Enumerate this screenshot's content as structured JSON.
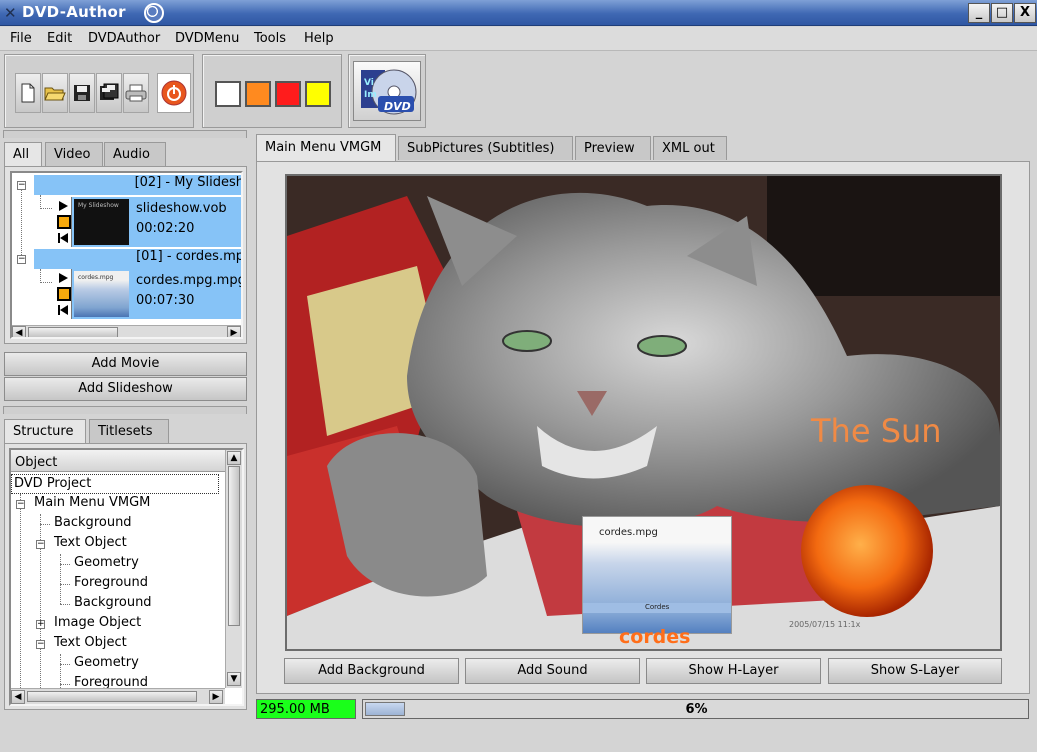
{
  "window": {
    "title": "DVD-Author",
    "min": "_",
    "max": "□",
    "close": "X"
  },
  "menu": [
    "File",
    "Edit",
    "DVDAuthor",
    "DVDMenu",
    "Tools",
    "Help"
  ],
  "toolbar": {
    "swatch_colors": [
      "#ffffff",
      "#ff8a1f",
      "#ff1c1c",
      "#ffff00"
    ],
    "logo_text": "DVD",
    "logo_tag_1": "Vi",
    "logo_tag_2": "Im"
  },
  "source_tabs": [
    "All",
    "Video",
    "Audio"
  ],
  "sources": [
    {
      "title": "[02] - My Slidesh",
      "file": "slideshow.vob",
      "duration": "00:02:20",
      "thumb_caption": "My Slideshow"
    },
    {
      "title": "[01] - cordes.mp",
      "file": "cordes.mpg.mpg",
      "duration": "00:07:30",
      "thumb_caption": "cordes.mpg"
    }
  ],
  "source_buttons": {
    "add_movie": "Add Movie",
    "add_slideshow": "Add Slideshow"
  },
  "structure_tabs": [
    "Structure",
    "Titlesets"
  ],
  "structure": {
    "header": "Object",
    "items": [
      "DVD Project",
      "Main Menu VMGM",
      "Background",
      "Text Object",
      "Geometry",
      "Foreground",
      "Background",
      "Image Object",
      "Text Object",
      "Geometry",
      "Foreground"
    ]
  },
  "main_tabs": [
    "Main Menu VMGM",
    "SubPictures (Subtitles)",
    "Preview",
    "XML out"
  ],
  "canvas": {
    "sun_label": "The Sun",
    "movie_title": "cordes.mpg",
    "movie_bar_text": "Cordes",
    "movie_label": "cordes",
    "photo_timestamp": "2005/07/15 11:1x"
  },
  "canvas_buttons": [
    "Add Background",
    "Add Sound",
    "Show H-Layer",
    "Show S-Layer"
  ],
  "status": {
    "size": "295.00 MB",
    "progress_label": "6%",
    "progress": 0.06
  }
}
